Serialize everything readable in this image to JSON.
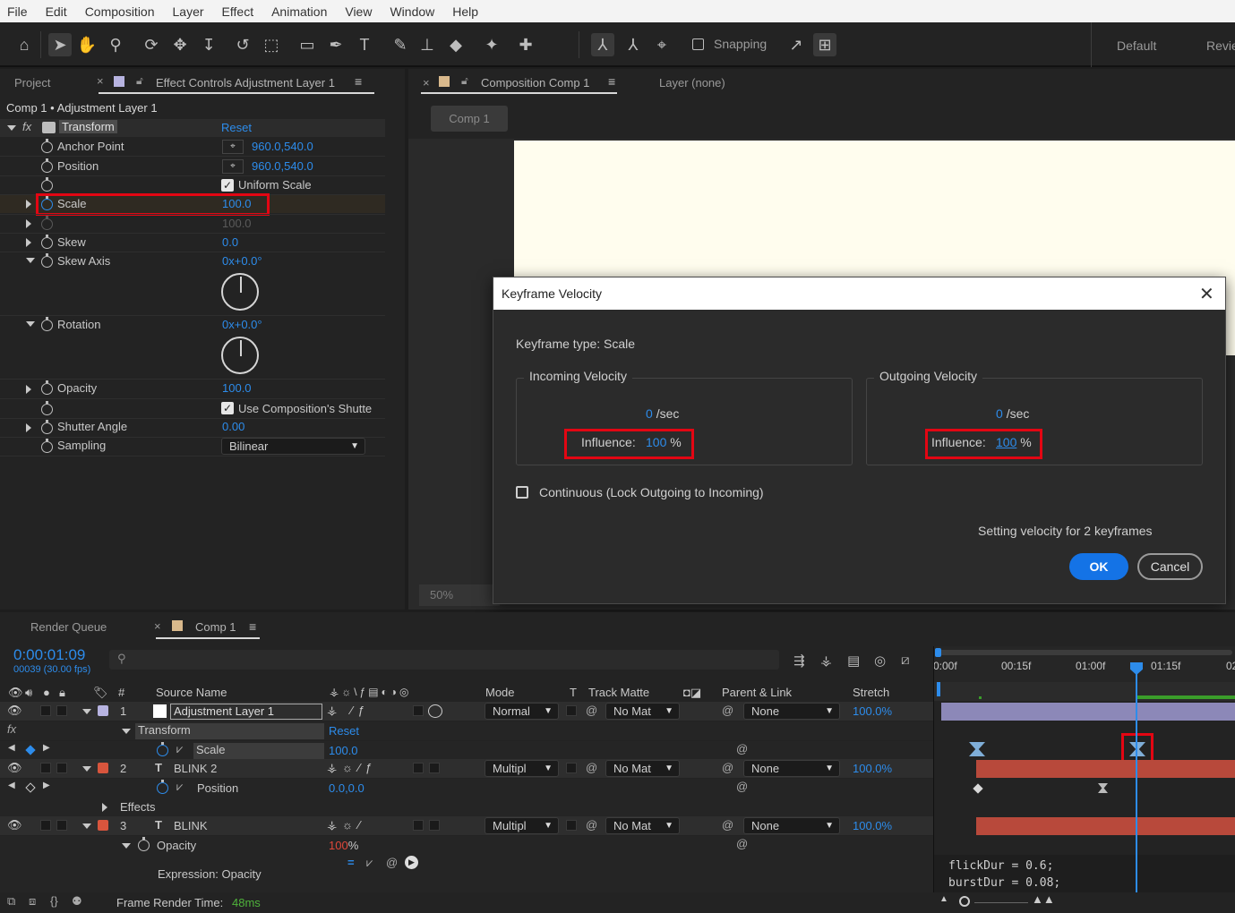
{
  "menu": [
    "File",
    "Edit",
    "Composition",
    "Layer",
    "Effect",
    "Animation",
    "View",
    "Window",
    "Help"
  ],
  "toolbar": {
    "snapping_label": "Snapping",
    "workspace_default": "Default",
    "workspace_review": "Revie"
  },
  "project_tab": "Project",
  "effect_controls_tab": "Effect Controls Adjustment Layer 1",
  "ec_breadcrumb": "Comp 1 • Adjustment Layer 1",
  "ec": {
    "fx": "fx",
    "transform": "Transform",
    "reset": "Reset",
    "anchor_point": "Anchor Point",
    "anchor_point_val": "960.0,540.0",
    "position": "Position",
    "position_val": "960.0,540.0",
    "uniform_scale": "Uniform Scale",
    "scale": "Scale",
    "scale_val": "100.0",
    "scale_val2": "100.0",
    "skew": "Skew",
    "skew_val": "0.0",
    "skew_axis": "Skew Axis",
    "skew_axis_val": "0x+0.0°",
    "rotation": "Rotation",
    "rotation_val": "0x+0.0°",
    "opacity": "Opacity",
    "opacity_val": "100.0",
    "use_comp_shutter": "Use Composition's Shutte",
    "shutter_angle": "Shutter Angle",
    "shutter_angle_val": "0.00",
    "sampling": "Sampling",
    "sampling_val": "Bilinear"
  },
  "comp_tab": "Composition Comp 1",
  "layer_tab": "Layer (none)",
  "comp_subtab": "Comp 1",
  "zoom": "50%",
  "dialog": {
    "title": "Keyframe Velocity",
    "kf_type": "Keyframe type: Scale",
    "incoming": "Incoming Velocity",
    "outgoing": "Outgoing Velocity",
    "in_vel": "0",
    "in_unit": "/sec",
    "out_vel": "0",
    "out_unit": "/sec",
    "influence_label": "Influence:",
    "in_influence": "100",
    "out_influence": "100",
    "pct": "%",
    "continuous": "Continuous (Lock Outgoing to Incoming)",
    "status": "Setting velocity for 2 keyframes",
    "ok": "OK",
    "cancel": "Cancel"
  },
  "timeline": {
    "render_queue": "Render Queue",
    "comp_tab": "Comp 1",
    "timecode": "0:00:01:09",
    "frames": "00039 (30.00 fps)",
    "search_placeholder": "",
    "ruler": [
      "0:00f",
      "00:15f",
      "01:00f",
      "01:15f",
      "02"
    ],
    "cols": {
      "source_name": "Source Name",
      "mode": "Mode",
      "t": "T",
      "track_matte": "Track Matte",
      "parent_link": "Parent & Link",
      "stretch": "Stretch",
      "num": "#"
    },
    "layers": [
      {
        "num": "1",
        "name": "Adjustment Layer 1",
        "mode": "Normal",
        "matte": "No Mat",
        "parent": "None",
        "stretch": "100.0%",
        "color": "#b7b3e0"
      },
      {
        "num": "2",
        "name": "BLINK 2",
        "mode": "Multipl",
        "matte": "No Mat",
        "parent": "None",
        "stretch": "100.0%",
        "color": "#d8553d"
      },
      {
        "num": "3",
        "name": "BLINK",
        "mode": "Multipl",
        "matte": "No Mat",
        "parent": "None",
        "stretch": "100.0%",
        "color": "#d8553d"
      }
    ],
    "transform": "Transform",
    "reset": "Reset",
    "scale": "Scale",
    "scale_val": "100.0",
    "position": "Position",
    "position_val": "0.0,0.0",
    "effects": "Effects",
    "opacity": "Opacity",
    "opacity_val": "100",
    "opacity_pct": "%",
    "expression_label": "Expression: Opacity",
    "expr_line1": "flickDur = 0.6;",
    "expr_line2": "burstDur = 0.08;",
    "frame_render_label": "Frame Render Time:",
    "frame_render_val": "48ms"
  },
  "colors": {
    "accent": "#2d8ceb",
    "ok": "#1473e6",
    "highlight": "#e30613",
    "layer_red": "#b8493b",
    "adjust_bar": "#8c88b8"
  }
}
